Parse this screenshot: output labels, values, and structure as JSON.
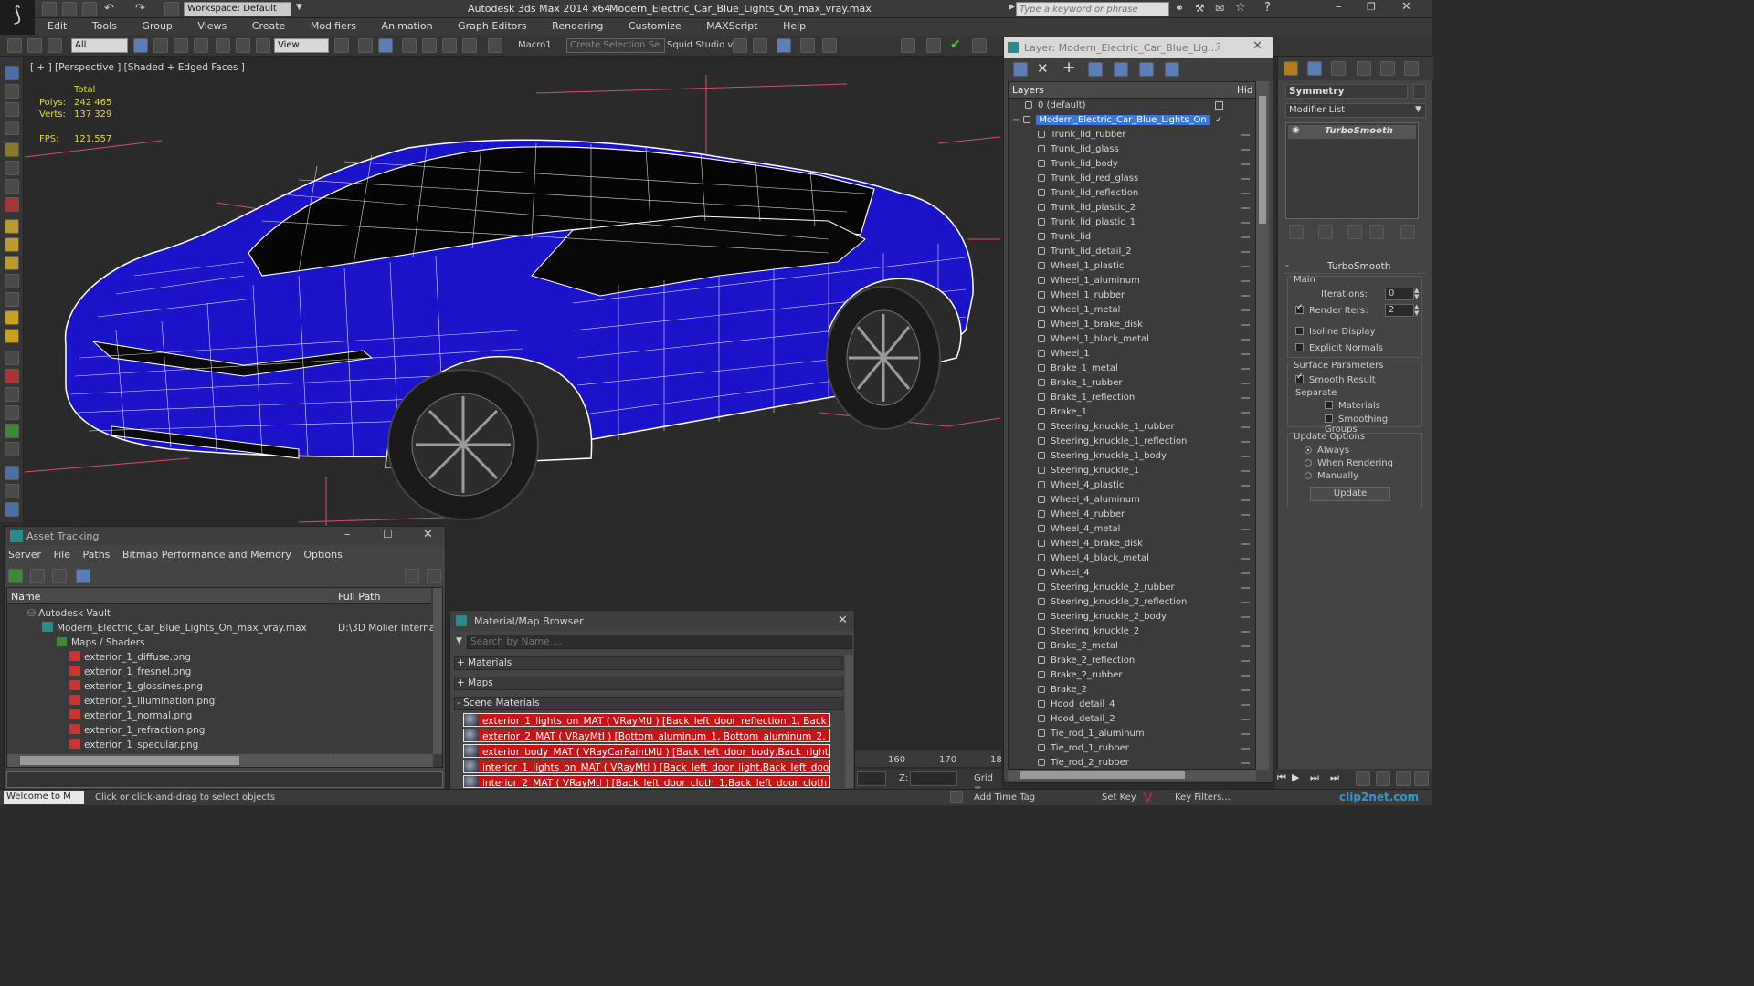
{
  "title_bar": {
    "workspace": "Workspace: Default",
    "app": "Autodesk 3ds Max  2014 x64",
    "file": "Modern_Electric_Car_Blue_Lights_On_max_vray.max",
    "search_placeholder": "Type a keyword or phrase"
  },
  "menu": [
    "Edit",
    "Tools",
    "Group",
    "Views",
    "Create",
    "Modifiers",
    "Animation",
    "Graph Editors",
    "Rendering",
    "Customize",
    "MAXScript",
    "Help"
  ],
  "toolbar": {
    "filter": "All",
    "view": "View",
    "macro": "Macro1",
    "selection_set": "Create Selection Se",
    "squid": "Squid Studio v"
  },
  "viewport": {
    "label": "[ + ] [Perspective ] [Shaded + Edged Faces ]",
    "stats_total": "Total",
    "polys_label": "Polys:",
    "polys": "242 465",
    "verts_label": "Verts:",
    "verts": "137 329",
    "fps_label": "FPS:",
    "fps": "121,557"
  },
  "asset_tracking": {
    "title": "Asset Tracking",
    "menu": [
      "Server",
      "File",
      "Paths",
      "Bitmap Performance and Memory",
      "Options"
    ],
    "col_name": "Name",
    "col_path": "Full Path",
    "vault": "Autodesk Vault",
    "file": "Modern_Electric_Car_Blue_Lights_On_max_vray.max",
    "file_path": "D:\\3D Molier Interna",
    "maps": "Maps / Shaders",
    "items": [
      "exterior_1_diffuse.png",
      "exterior_1_fresnel.png",
      "exterior_1_glossines.png",
      "exterior_1_illumination.png",
      "exterior_1_normal.png",
      "exterior_1_refraction.png",
      "exterior_1_specular.png"
    ]
  },
  "material_browser": {
    "title": "Material/Map Browser",
    "search": "Search by Name ...",
    "sections": [
      "+ Materials",
      "+ Maps",
      "- Scene Materials"
    ],
    "materials": [
      "exterior_1_lights_on_MAT ( VRayMtl ) [Back_left_door_reflection_1, Back_left_...",
      "exterior_2_MAT  ( VRayMtl ) [Bottom_aluminum_1, Bottom_aluminum_2, Botto...",
      "exterior_body_MAT ( VRayCarPaintMtl ) [Back_left_door_body,Back_right_door...",
      "interior_1_lights_on_MAT ( VRayMtl ) [Back_left_door_light,Back_left_door_pla...",
      "interior_2_MAT  ( VRayMtl ) [Back_left_door_cloth_1,Back_left_door_cloth_2,B..."
    ]
  },
  "layer_panel": {
    "title": "Layer: Modern_Electric_Car_Blue_Lig...",
    "help": "?",
    "col_layers": "Layers",
    "col_hide": "Hid",
    "default_layer": "0 (default)",
    "active_layer": "Modern_Electric_Car_Blue_Lights_On",
    "items": [
      "Trunk_lid_rubber",
      "Trunk_lid_glass",
      "Trunk_lid_body",
      "Trunk_lid_red_glass",
      "Trunk_lid_reflection",
      "Trunk_lid_plastic_2",
      "Trunk_lid_plastic_1",
      "Trunk_lid",
      "Trunk_lid_detail_2",
      "Wheel_1_plastic",
      "Wheel_1_aluminum",
      "Wheel_1_rubber",
      "Wheel_1_metal",
      "Wheel_1_brake_disk",
      "Wheel_1_black_metal",
      "Wheel_1",
      "Brake_1_metal",
      "Brake_1_rubber",
      "Brake_1_reflection",
      "Brake_1",
      "Steering_knuckle_1_rubber",
      "Steering_knuckle_1_reflection",
      "Steering_knuckle_1_body",
      "Steering_knuckle_1",
      "Wheel_4_plastic",
      "Wheel_4_aluminum",
      "Wheel_4_rubber",
      "Wheel_4_metal",
      "Wheel_4_brake_disk",
      "Wheel_4_black_metal",
      "Wheel_4",
      "Steering_knuckle_2_rubber",
      "Steering_knuckle_2_reflection",
      "Steering_knuckle_2_body",
      "Steering_knuckle_2",
      "Brake_2_metal",
      "Brake_2_reflection",
      "Brake_2_rubber",
      "Brake_2",
      "Hood_detail_4",
      "Hood_detail_2",
      "Tie_rod_1_aluminum",
      "Tie_rod_1_rubber",
      "Tie_rod_2_rubber"
    ]
  },
  "command_panel": {
    "object_name": "Symmetry",
    "modifier_list": "Modifier List",
    "stack_item": "TurboSmooth",
    "rollout": "TurboSmooth",
    "main": "Main",
    "iterations_label": "Iterations:",
    "iterations": "0",
    "render_iters_label": "Render Iters:",
    "render_iters": "2",
    "isoline": "Isoline Display",
    "explicit": "Explicit Normals",
    "surface": "Surface Parameters",
    "smooth_result": "Smooth Result",
    "separate": "Separate",
    "materials": "Materials",
    "smoothing_groups": "Smoothing Groups",
    "update_options": "Update Options",
    "always": "Always",
    "when_rendering": "When Rendering",
    "manually": "Manually",
    "update_btn": "Update"
  },
  "timeline": {
    "t160": "160",
    "t170": "170",
    "t18": "18",
    "z_label": "Z:",
    "grid_label": "Grid ="
  },
  "status": {
    "welcome": "Welcome to M",
    "prompt": "Click or click-and-drag to select objects",
    "add_time_tag": "Add Time Tag",
    "set_key": "Set Key",
    "key_filters": "Key Filters...",
    "watermark": "clip2net.com"
  },
  "colors": {
    "ui_bg": "#2b2b2b",
    "viewport_bg": "#2a2a2a",
    "car_blue": "#1a13c9",
    "selected": "#3a78d6",
    "red_material": "#c71414"
  }
}
